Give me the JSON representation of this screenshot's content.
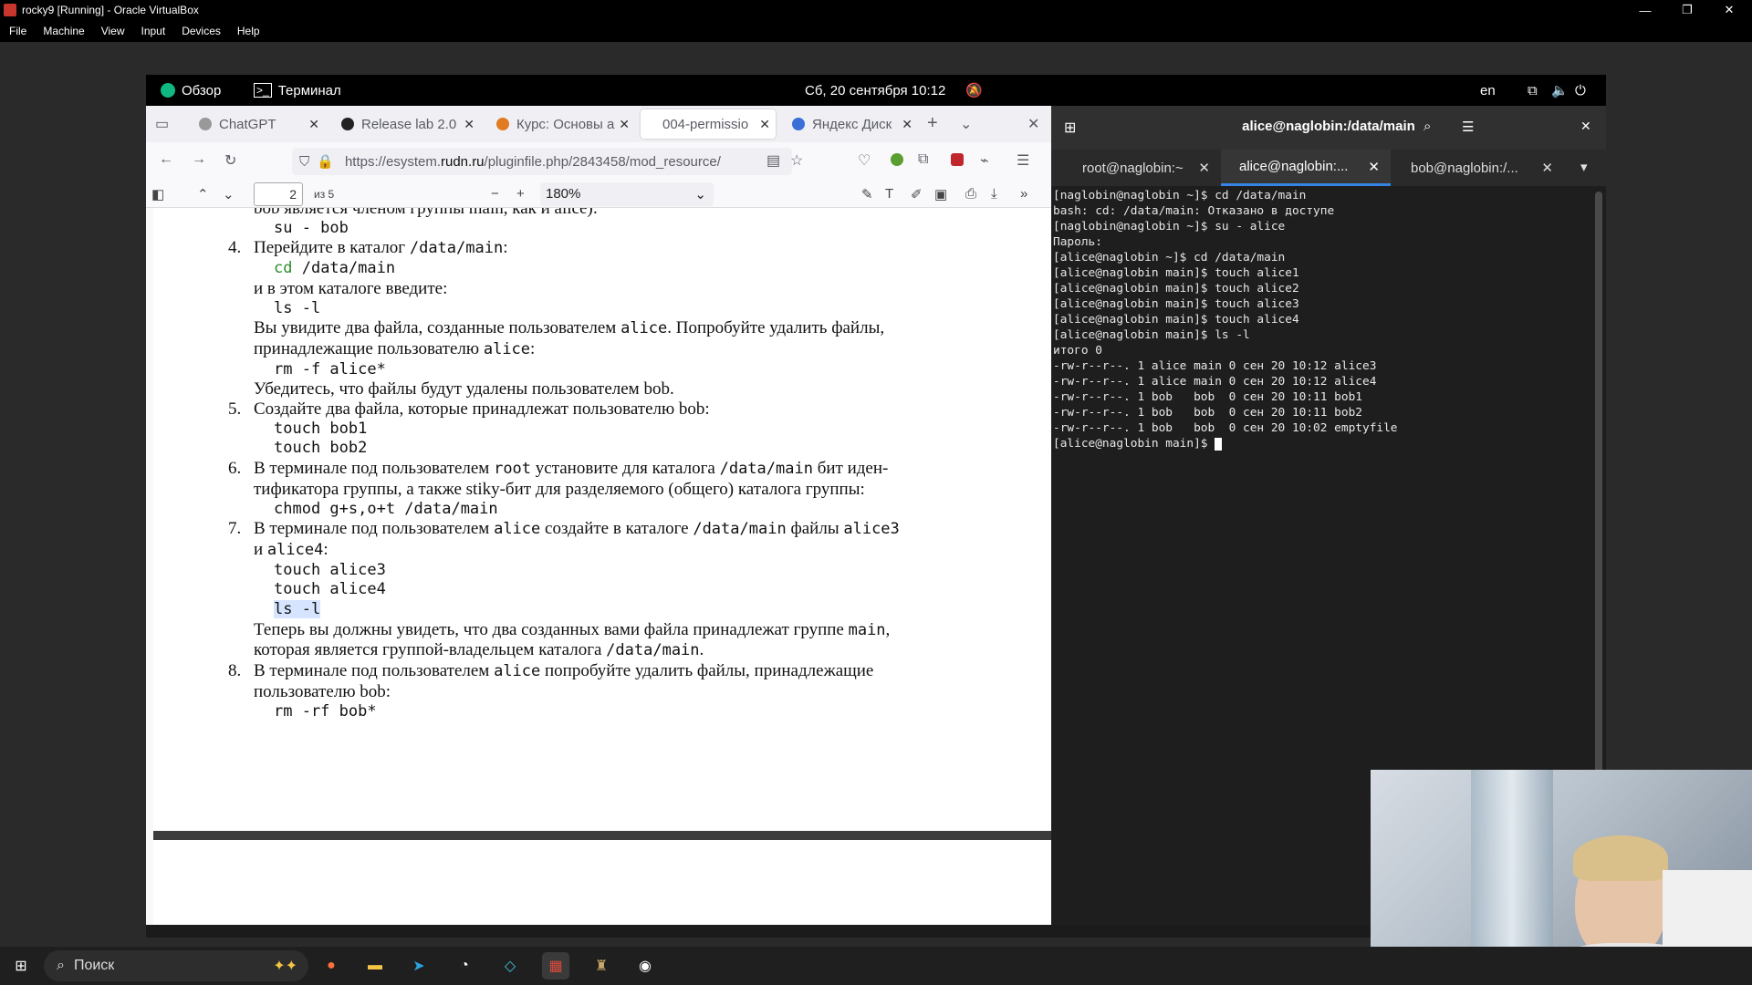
{
  "host": {
    "title": "rocky9 [Running] - Oracle VirtualBox",
    "menu": [
      "File",
      "Machine",
      "View",
      "Input",
      "Devices",
      "Help"
    ]
  },
  "gnome": {
    "overview": "Обзор",
    "terminal_app": "Терминал",
    "clock": "Сб, 20 сентября  10:12",
    "lang": "en"
  },
  "firefox": {
    "tabs": [
      {
        "label": "ChatGPT",
        "color": "#888"
      },
      {
        "label": "Release lab 2.0",
        "color": "#111"
      },
      {
        "label": "Курс: Основы а",
        "color": "#e07b22"
      },
      {
        "label": "004-permissio",
        "color": "#999"
      },
      {
        "label": "Яндекс Диск",
        "color": "#3a6fd8"
      }
    ],
    "url_pre": "https://esystem.",
    "url_host": "rudn.ru",
    "url_post": "/pluginfile.php/2843458/mod_resource/",
    "page_num": "2",
    "page_of": "из 5",
    "zoom": "180%"
  },
  "doc": {
    "l0": "bob является членом группы main, как и alice):",
    "l1": "su - bob",
    "n4": "4.",
    "l2a": "Перейдите в каталог ",
    "l2b": "/data/main",
    "l2c": ":",
    "l3a": "cd",
    "l3b": " /data/main",
    "l4": "и в этом каталоге введите:",
    "l5": "ls -l",
    "l6a": "Вы увидите два файла, созданные пользователем ",
    "l6b": "alice",
    "l6c": ". Попробуйте удалить файлы,",
    "l7a": "принадлежащие пользователю ",
    "l7b": "alice",
    "l7c": ":",
    "l8": "rm -f alice*",
    "l9": "Убедитесь, что файлы будут удалены пользователем bob.",
    "n5": "5.",
    "l10": "Создайте два файла, которые принадлежат пользователю bob:",
    "l11": "touch bob1",
    "l12": "touch bob2",
    "n6": "6.",
    "l13a": "В терминале под пользователем ",
    "l13b": "root",
    "l13c": " установите для каталога ",
    "l13d": "/data/main",
    "l13e": " бит иден-",
    "l14": "тификатора группы, а также stiky-бит для разделяемого (общего) каталога группы:",
    "l15": "chmod g+s,o+t /data/main",
    "n7": "7.",
    "l16a": "В терминале под пользователем ",
    "l16b": "alice",
    "l16c": " создайте в каталоге ",
    "l16d": "/data/main",
    "l16e": " файлы ",
    "l16f": "alice3",
    "l17a": "и ",
    "l17b": "alice4",
    "l17c": ":",
    "l18": "touch alice3",
    "l19": "touch alice4",
    "l20": "ls -l",
    "l21a": "Теперь вы должны увидеть, что два созданных вами файла принадлежат группе ",
    "l21b": "main",
    "l21c": ",",
    "l22a": "которая является группой-владельцем каталога ",
    "l22b": "/data/main",
    "l22c": ".",
    "n8": "8.",
    "l23a": "В терминале под пользователем ",
    "l23b": "alice",
    "l23c": " попробуйте удалить файлы, принадлежащие",
    "l24": "пользователю bob:",
    "l25": "rm -rf bob*"
  },
  "terminal": {
    "title": "alice@naglobin:/data/main",
    "tabs": [
      "root@naglobin:~",
      "alice@naglobin:...",
      "bob@naglobin:/..."
    ],
    "lines": [
      "[naglobin@naglobin ~]$ cd /data/main",
      "bash: cd: /data/main: Отказано в доступе",
      "[naglobin@naglobin ~]$ su - alice",
      "Пароль:",
      "[alice@naglobin ~]$ cd /data/main",
      "[alice@naglobin main]$ touch alice1",
      "[alice@naglobin main]$ touch alice2",
      "[alice@naglobin main]$ touch alice3",
      "[alice@naglobin main]$ touch alice4",
      "[alice@naglobin main]$ ls -l",
      "итого 0",
      "-rw-r--r--. 1 alice main 0 сен 20 10:12 alice3",
      "-rw-r--r--. 1 alice main 0 сен 20 10:12 alice4",
      "-rw-r--r--. 1 bob   bob  0 сен 20 10:11 bob1",
      "-rw-r--r--. 1 bob   bob  0 сен 20 10:11 bob2",
      "-rw-r--r--. 1 bob   bob  0 сен 20 10:02 emptyfile",
      "[alice@naglobin main]$ "
    ]
  },
  "taskbar": {
    "search": "Поиск"
  }
}
